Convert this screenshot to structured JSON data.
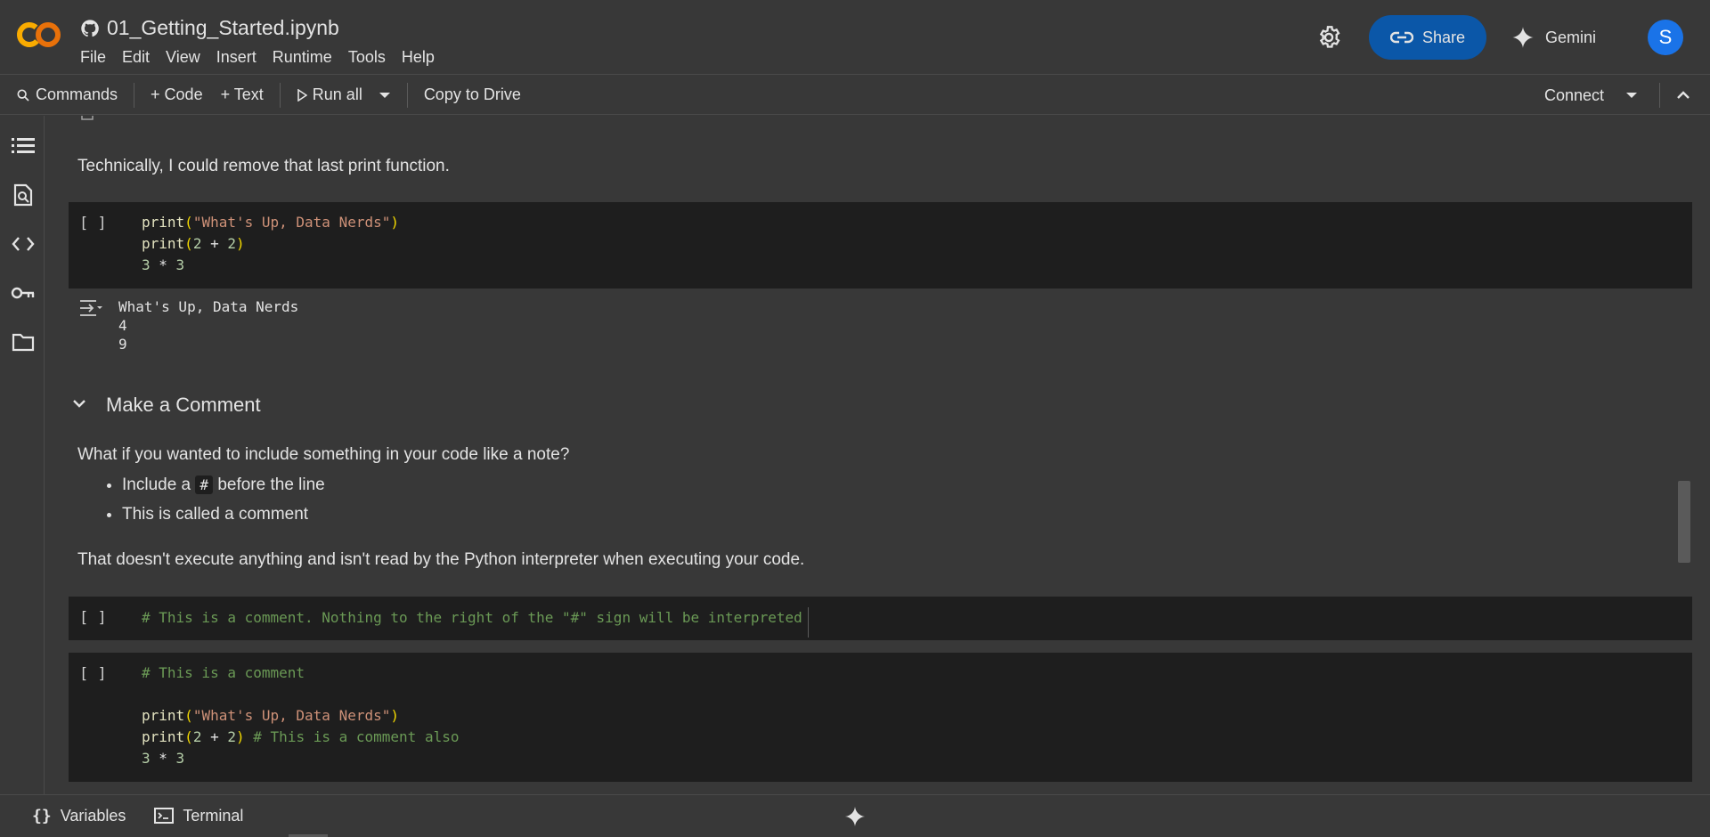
{
  "header": {
    "notebook_title": "01_Getting_Started.ipynb",
    "menu": [
      "File",
      "Edit",
      "View",
      "Insert",
      "Runtime",
      "Tools",
      "Help"
    ],
    "share_label": "Share",
    "gemini_label": "Gemini",
    "avatar_letter": "S"
  },
  "toolbar": {
    "commands_label": "Commands",
    "code_label": "+ Code",
    "text_label": "+ Text",
    "run_all_label": "Run all",
    "copy_to_drive_label": "Copy to Drive",
    "connect_label": "Connect"
  },
  "content": {
    "intro_text": "Technically, I could remove that last print function.",
    "cell1_bracket": "[ ]",
    "cell1_output": [
      "What's Up, Data Nerds",
      "4",
      "9"
    ],
    "section_title": "Make a Comment",
    "para1": "What if you wanted to include something in your code like a note?",
    "bullet1_pre": "Include a",
    "bullet1_code": "#",
    "bullet1_post": "before the line",
    "bullet2": "This is called a comment",
    "para2": "That doesn't execute anything and isn't read by the Python interpreter when executing your code.",
    "cell2_bracket": "[ ]",
    "cell2_code": "# This is a comment. Nothing to the right of the \"#\" sign will be interpreted",
    "cell3_bracket": "[ ]",
    "cell3_line1": "# This is a comment",
    "cell3_comment_also": "# This is a comment also"
  },
  "bottom": {
    "variables_label": "Variables",
    "terminal_label": "Terminal"
  },
  "colors": {
    "background": "#383838",
    "cell_bg": "#1e1e1e",
    "share_bg": "#0b57a8",
    "avatar_bg": "#1a73e8",
    "string": "#ce9178",
    "comment": "#6a9955",
    "paren": "#f1d700"
  }
}
